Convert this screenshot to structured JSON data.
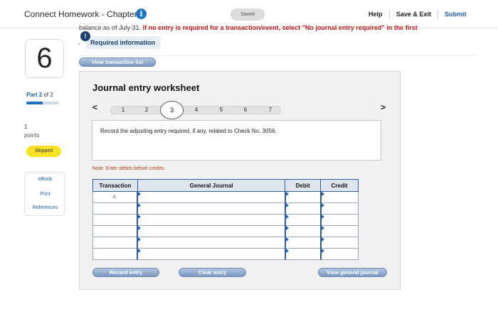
{
  "header": {
    "title": "Connect Homework - Chapter 6",
    "info_icon": "info-icon",
    "saved": "Saved",
    "help": "Help",
    "save_exit": "Save & Exit",
    "submit": "Submit"
  },
  "cutoff_text": {
    "normal": "balance as of July 31.",
    "red": "If no entry is required for a transaction/event, select \"No journal entry required\" in the first"
  },
  "question": {
    "number": "6",
    "part_label_prefix": "Part 2",
    "part_label_suffix": "of 2",
    "part_progress": 0.5,
    "points_value": "1",
    "points_label": "points",
    "status": "Skipped"
  },
  "side_links": [
    "eBook",
    "Print",
    "References"
  ],
  "required_info": {
    "icon": "!",
    "comma": ",",
    "label": "Required information"
  },
  "buttons": {
    "view_transaction_list": "View transaction list",
    "record_entry": "Record entry",
    "clear_entry": "Clear entry",
    "view_general_journal": "View general journal"
  },
  "worksheet": {
    "title": "Journal entry worksheet",
    "pages": [
      "1",
      "2",
      "3",
      "4",
      "5",
      "6",
      "7"
    ],
    "active_page": "3",
    "prev": "<",
    "next": ">",
    "instruction": "Record the adjusting entry required, if any, related to Check No. 3056.",
    "note": "Note: Enter debits before credits."
  },
  "table": {
    "headers": [
      "Transaction",
      "General Journal",
      "Debit",
      "Credit"
    ],
    "rows": [
      {
        "transaction": "c."
      },
      {
        "transaction": ""
      },
      {
        "transaction": ""
      },
      {
        "transaction": ""
      },
      {
        "transaction": ""
      },
      {
        "transaction": ""
      }
    ]
  }
}
